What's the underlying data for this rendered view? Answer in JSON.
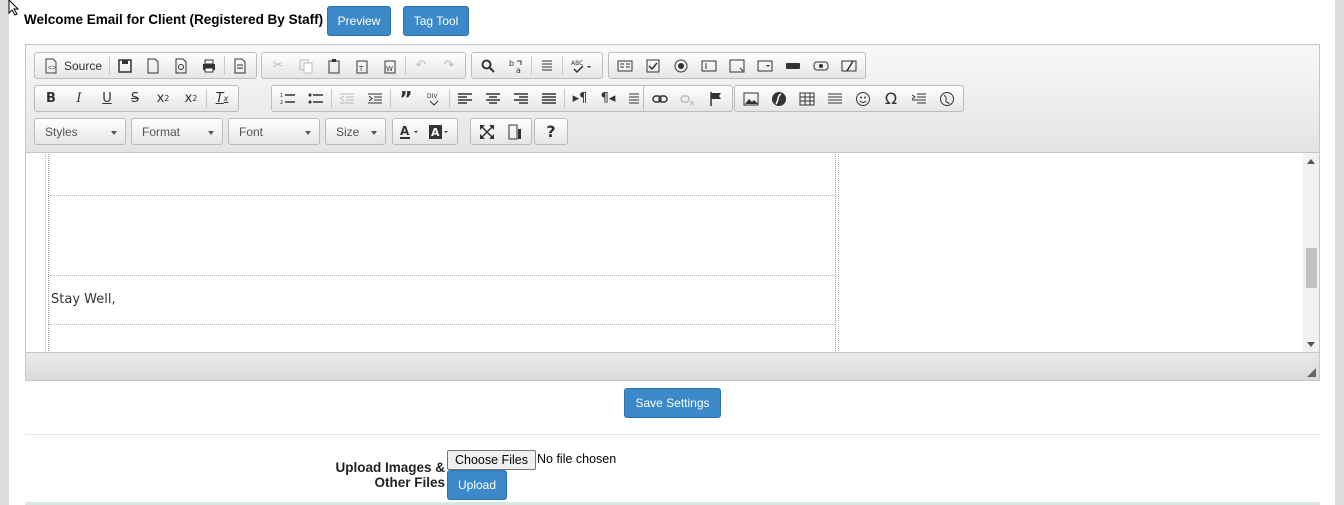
{
  "header": {
    "title": "Welcome Email for Client (Registered By Staff)",
    "preview_label": "Preview",
    "tagtool_label": "Tag Tool"
  },
  "toolbar": {
    "source_label": "Source",
    "styles_label": "Styles",
    "format_label": "Format",
    "font_label": "Font",
    "size_label": "Size"
  },
  "content": {
    "text": "Stay Well,"
  },
  "footer": {
    "save_label": "Save Settings",
    "upload_label": "Upload Images & Other Files",
    "choose_files_label": "Choose Files",
    "file_status": "No file chosen",
    "upload_button_label": "Upload"
  },
  "colors": {
    "button_blue": "#3c89c9",
    "page_bg": "#ffffff"
  }
}
